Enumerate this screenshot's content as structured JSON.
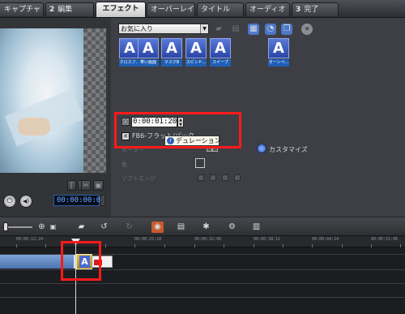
{
  "tabs": [
    {
      "num": "",
      "label": "キャプチャ"
    },
    {
      "num": "2",
      "label": "編集"
    },
    {
      "num": "",
      "label": "エフェクト"
    },
    {
      "num": "",
      "label": "オーバーレイ"
    },
    {
      "num": "",
      "label": "タイトル"
    },
    {
      "num": "",
      "label": "オーディオ"
    },
    {
      "num": "3",
      "label": "完了"
    }
  ],
  "gallery": {
    "dropdown_value": "お気に入り",
    "thumbs": [
      {
        "glyph": "A",
        "label": "クロスフ..."
      },
      {
        "glyph": "A",
        "label": "帯い画面"
      },
      {
        "glyph": "A",
        "label": "マスクB"
      },
      {
        "glyph": "A",
        "label": "スピンド..."
      },
      {
        "glyph": "A",
        "label": "スイープ"
      },
      {
        "glyph": "A",
        "label": "ターンペ..."
      }
    ]
  },
  "options": {
    "duration_value": "0:00:01:20",
    "duration_icon_text": "○",
    "fill_label": "FB6-フラット/パック",
    "tooltip_text": "デュレーション",
    "tooltip_icon": "i",
    "customize_label": "カスタマイズ",
    "dim_labels": [
      "ボーダー",
      "色",
      "ソフトエッジ"
    ]
  },
  "preview": {
    "timecode": "00:00:00:00",
    "play_symbol": "⏻",
    "volume_symbol": "◀)"
  },
  "ruler": {
    "labels": [
      "00:00:12:24",
      "00:00:25:18",
      "00:00:32:00",
      "00:00:38:12",
      "00:00:44:24",
      "00:00:51:06"
    ]
  },
  "clips": {
    "transition_glyph": "A"
  },
  "colors": {
    "highlight": "#ff1a1a",
    "thumb_blue": "#2a47a8",
    "timecode_text": "#6aa8ff"
  },
  "icons": [
    "folder-icon",
    "undo-icon",
    "redo-icon",
    "gear-icon",
    "settings-icon"
  ]
}
